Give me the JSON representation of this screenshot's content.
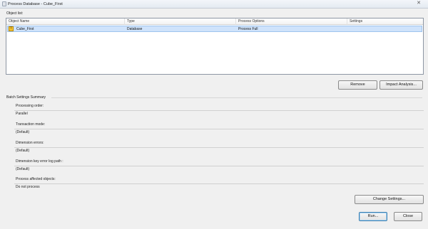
{
  "window": {
    "title": "Process Database - Cube_First",
    "close_glyph": "✕"
  },
  "object_list": {
    "label": "Object list:",
    "columns": [
      "Object Name",
      "Type",
      "Process Options",
      "Settings"
    ],
    "rows": [
      {
        "name": "Cube_First",
        "type": "Database",
        "process_options": "Process Full",
        "settings": "",
        "icon": "warning-icon"
      }
    ]
  },
  "buttons": {
    "remove": "Remove",
    "impact_analysis": "Impact Analysis...",
    "change_settings": "Change Settings...",
    "run": "Run...",
    "close": "Close"
  },
  "batch_settings": {
    "header": "Batch Settings Summary",
    "fields": [
      {
        "label": "Processing order:",
        "value": "Parallel"
      },
      {
        "label": "Transaction mode:",
        "value": "(Default)"
      },
      {
        "label": "Dimension errors:",
        "value": "(Default)"
      },
      {
        "label": "Dimension key error log path :",
        "value": "(Default)"
      },
      {
        "label": "Process affected objects:",
        "value": "Do not process"
      }
    ]
  },
  "colors": {
    "selection": "#cfe3fb",
    "default_button_border": "#3c7fb1"
  }
}
